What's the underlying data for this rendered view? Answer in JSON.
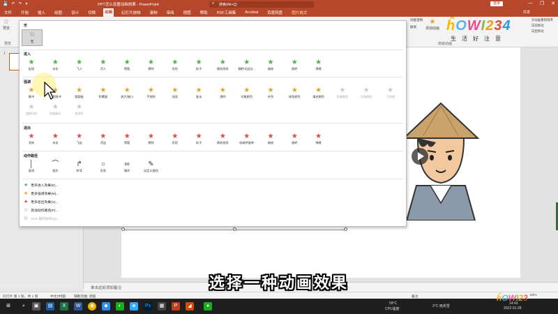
{
  "titlebar": {
    "quick_access": [
      "💾",
      "↶",
      "↷",
      "▾"
    ],
    "doc_title": "PPT怎么设置动画效果 - PowerPoint",
    "search_placeholder": "搜索(Alt+Q)",
    "login_label": "登录",
    "window_buttons": [
      "—",
      "❐",
      "✕"
    ]
  },
  "ribbon_tabs": [
    "文件",
    "开始",
    "插入",
    "绘图",
    "设计",
    "切换",
    "动画",
    "幻灯片放映",
    "录制",
    "审阅",
    "视图",
    "帮助",
    "PDF工具集",
    "Acrobat",
    "百度网盘",
    "图片格式"
  ],
  "active_tab": "动画",
  "share_label": "共享",
  "ribbon": {
    "preview_label": "预览",
    "preview_group": "预览",
    "animation_pane": "动画窗格",
    "trigger": "触发",
    "add_animation": "添加动画",
    "advanced_group": "高级动画",
    "reorder": "对动画重新排序",
    "forward": "向前移动",
    "backward": "向后移动"
  },
  "logo": {
    "brand": "ĥOWI234",
    "chars": [
      "生",
      "活",
      "好",
      "注",
      "意"
    ]
  },
  "slide_number": "1",
  "gallery": {
    "sections": {
      "none": "无",
      "entrance": "进入",
      "emphasis": "强调",
      "exit": "退出",
      "motion": "动作路径"
    },
    "none_tile_label": "无",
    "entrance": [
      "出现",
      "淡化",
      "飞入",
      "浮入",
      "劈裂",
      "擦除",
      "形状",
      "轮子",
      "随机线条",
      "翻转式由远...",
      "缩放",
      "旋转",
      "弹跳"
    ],
    "emphasis_row1": [
      "脉冲",
      "彩色脉冲",
      "跷跷板",
      "陀螺旋",
      "放大/缩小",
      "不饱和",
      "加深",
      "变淡",
      "透明",
      "对象颜色",
      "补色",
      "线条颜色",
      "填充颜色",
      "画笔颜色",
      "字体颜色",
      "下划线"
    ],
    "emphasis_row2": [
      "加粗闪烁",
      "加粗展示",
      "波浪形"
    ],
    "exit": [
      "消失",
      "淡化",
      "飞出",
      "浮出",
      "劈裂",
      "擦除",
      "形状",
      "轮子",
      "随机线条",
      "收缩并旋转",
      "缩放",
      "旋转",
      "弹跳"
    ],
    "motion": [
      "直线",
      "弧形",
      "转弯",
      "形状",
      "循环",
      "自定义路径"
    ],
    "more_links": [
      "更多进入效果(E)...",
      "更多强调效果(M)...",
      "更多退出效果(X)...",
      "其他动作路径(P)...",
      "OLE 操作动作(Q)..."
    ]
  },
  "notes_placeholder": "单击此处添加备注",
  "caption": "选择一种动画效果",
  "statusbar": {
    "slide_info": "幻灯片 第 1 张，共 1 张",
    "language": "中文(中国)",
    "accessibility": "辅助功能: 调查",
    "notes": "备注",
    "zoom": "63%"
  },
  "taskbar": {
    "temp": "59°C",
    "cpu_label": "CPU温度",
    "weather": "2°C  雨夹雪",
    "time": "14:43",
    "date": "2022-01-28"
  },
  "watermark": "ĥOWI23"
}
